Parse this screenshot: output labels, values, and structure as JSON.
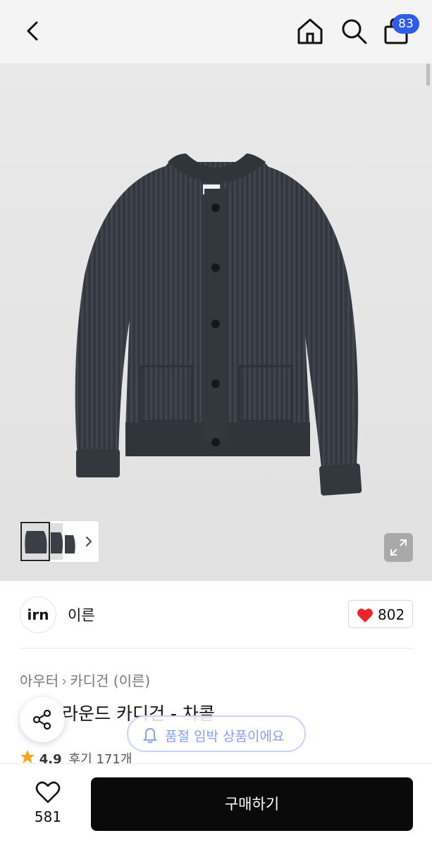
{
  "header": {
    "cart_count": "83",
    "icons": [
      "back-chevron-icon",
      "home-icon",
      "search-icon",
      "shopping-bag-icon"
    ]
  },
  "gallery": {
    "image_subject": "charcoal knit cardigan",
    "colors": {
      "background": "#e4e4e4",
      "garment": "#3a3f47",
      "expand_button": "#a9a9a9"
    }
  },
  "brand": {
    "logo_text": "irn",
    "name": "이른",
    "like_count": "802"
  },
  "breadcrumb": {
    "category": "아우터",
    "subcategory": "카디건 (이른)"
  },
  "product": {
    "title": "라운드 카디건 - 차콜",
    "rating": "4.9",
    "reviews": "후기 171개"
  },
  "toast": {
    "text": "품절 임박 상품이에요"
  },
  "bottom_bar": {
    "wish_count": "581",
    "buy_label": "구매하기"
  },
  "colors": {
    "accent_badge": "#2f5bea",
    "heart": "#e8242c",
    "buy_button": "#0a0a0a",
    "star": "#f5a623"
  }
}
